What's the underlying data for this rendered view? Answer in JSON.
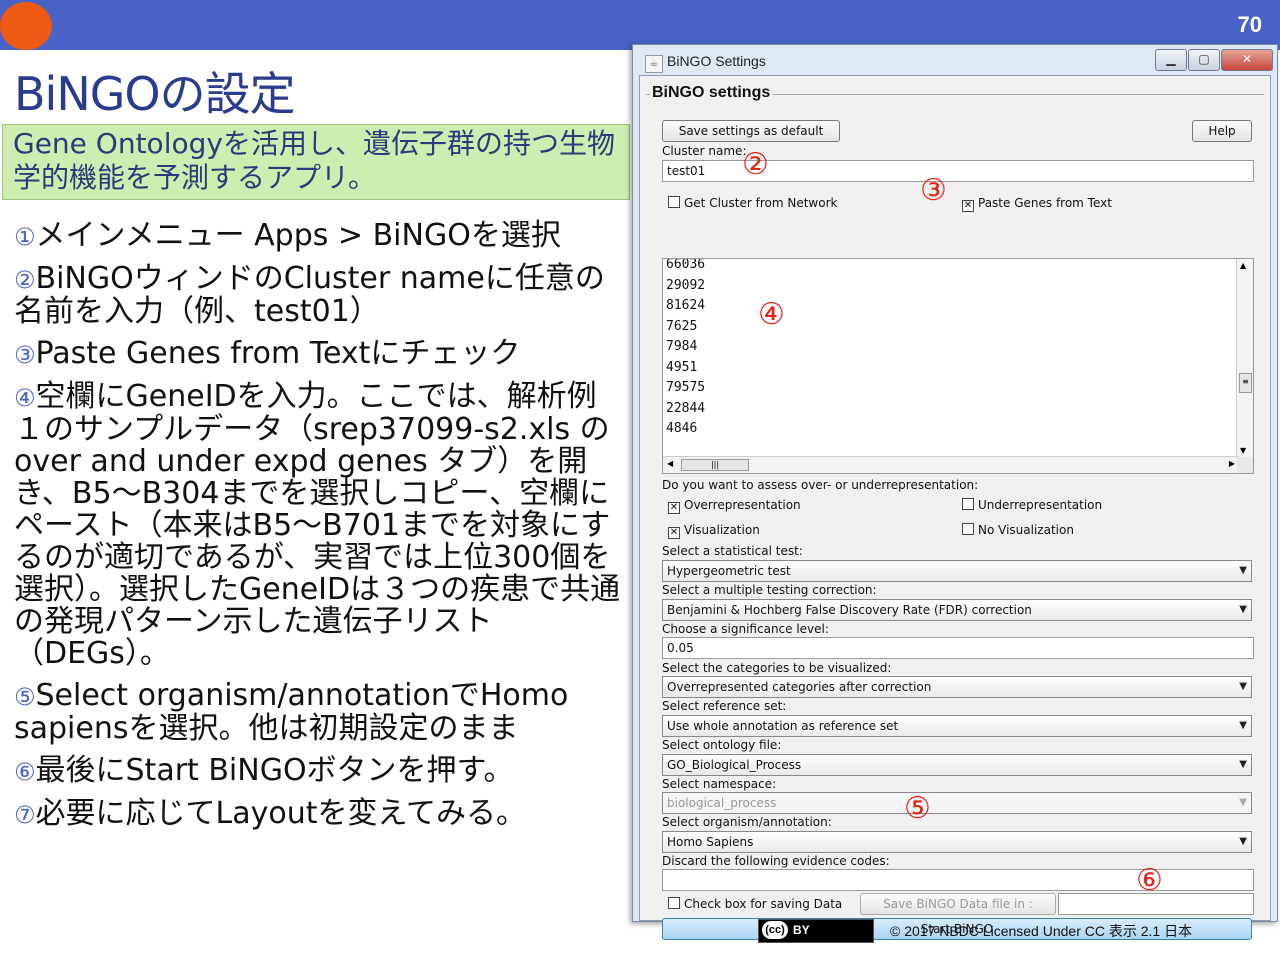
{
  "slide": {
    "page_number": "70",
    "title": "BiNGOの設定",
    "subtitle": "Gene Ontologyを活用し、遺伝子群の持つ生物学的機能を予測するアプリ。",
    "steps": [
      {
        "num": "①",
        "text": "メインメニュー Apps > BiNGOを選択"
      },
      {
        "num": "②",
        "text": "BiNGOウィンドのCluster nameに任意の名前を入力（例、test01）"
      },
      {
        "num": "③",
        "text": "Paste Genes from Textにチェック"
      },
      {
        "num": "④",
        "text": "空欄にGeneIDを入力。ここでは、解析例１のサンプルデータ（srep37099-s2.xls の over and under expd genes タブ）を開き、B5～B304までを選択しコピー、空欄にペースト（本来はB5～B701までを対象にするのが適切であるが、実習では上位300個を選択）。選択したGeneIDは３つの疾患で共通の発現パターン示した遺伝子リスト（DEGs）。"
      },
      {
        "num": "⑤",
        "text": "Select organism/annotationでHomo sapiensを選択。他は初期設定のまま"
      },
      {
        "num": "⑥",
        "text": "最後にStart BiNGOボタンを押す。"
      },
      {
        "num": "⑦",
        "text": "必要に応じてLayoutを変えてみる。"
      }
    ],
    "cc_badge_left": "(cc)",
    "cc_badge_right": "BY",
    "license": "© 2017  NBDC Licensed Under CC 表示 2.1 日本"
  },
  "window": {
    "title": "BiNGO Settings",
    "minimize": "▁",
    "maximize": "▢",
    "close": "✕",
    "group_title": "BiNGO settings",
    "save_default_label": "Save settings as default",
    "help_label": "Help",
    "cluster_name_label": "Cluster name:",
    "cluster_name_value": "test01",
    "get_cluster_label": "Get Cluster from Network",
    "get_cluster_checked": false,
    "paste_genes_label": "Paste Genes from Text",
    "paste_genes_checked": true,
    "gene_ids": [
      "66036",
      "29092",
      "81624",
      "7625",
      "7984",
      "4951",
      "79575",
      "22844",
      "4846"
    ],
    "assess_label": "Do you want to assess over- or underrepresentation:",
    "overrep_label": "Overrepresentation",
    "overrep_checked": true,
    "underrep_label": "Underrepresentation",
    "underrep_checked": false,
    "visualization_label": "Visualization",
    "visualization_checked": true,
    "no_visualization_label": "No Visualization",
    "no_visualization_checked": false,
    "stat_test_label": "Select a statistical test:",
    "stat_test_value": "Hypergeometric test",
    "correction_label": "Select a multiple testing correction:",
    "correction_value": "Benjamini & Hochberg False Discovery Rate (FDR) correction",
    "significance_label": "Choose a significance level:",
    "significance_value": "0.05",
    "categories_label": "Select the categories to be visualized:",
    "categories_value": "Overrepresented categories after correction",
    "reference_label": "Select reference set:",
    "reference_value": "Use whole annotation as reference set",
    "ontology_label": "Select ontology file:",
    "ontology_value": "GO_Biological_Process",
    "namespace_label": "Select namespace:",
    "namespace_value": "biological_process",
    "organism_label": "Select organism/annotation:",
    "organism_value": "Homo Sapiens",
    "evidence_label": "Discard the following evidence codes:",
    "evidence_value": "",
    "save_data_label": "Check box for saving Data",
    "save_data_checked": false,
    "save_file_label": "Save BiNGO Data file in :",
    "save_file_value": "",
    "start_label": "Start BiNGO"
  },
  "callouts": {
    "c2": "②",
    "c3": "③",
    "c4": "④",
    "c5": "⑤",
    "c6": "⑥"
  },
  "colors": {
    "topbar": "#4a63c8",
    "accent_circle": "#ee5a14",
    "subtitle_bg": "#cdeeb0",
    "callout": "#e2231a"
  }
}
